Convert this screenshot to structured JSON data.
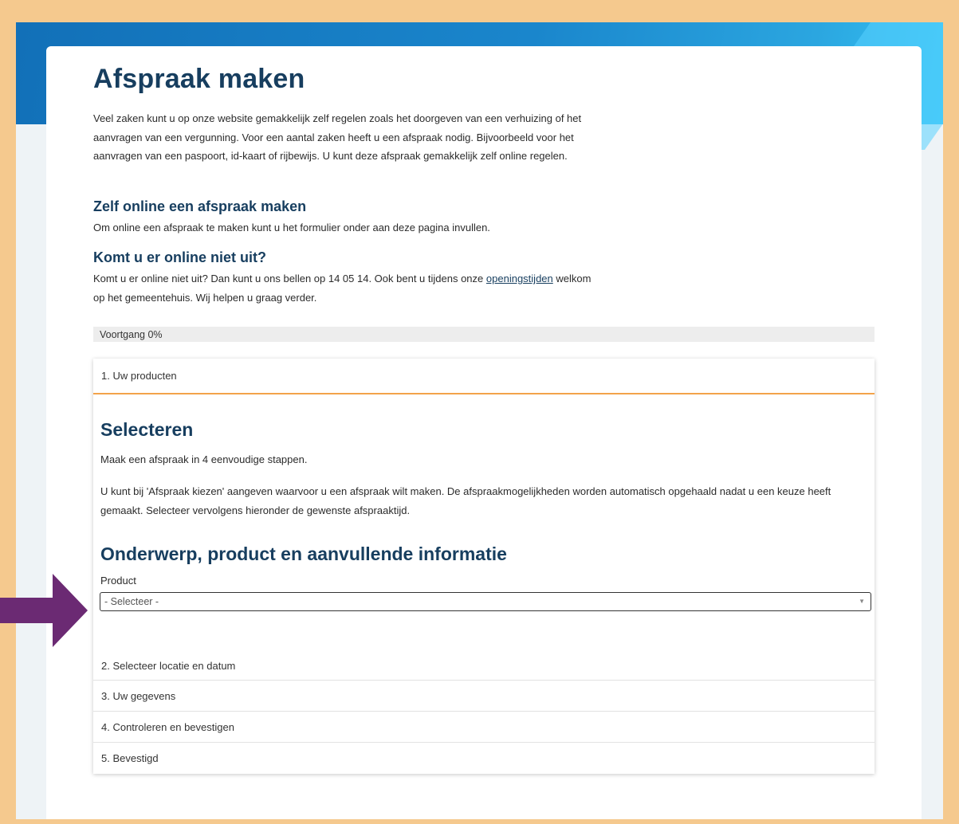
{
  "page": {
    "title": "Afspraak maken",
    "intro": "Veel zaken kunt u op onze website gemakkelijk zelf regelen zoals het doorgeven van een verhuizing of het aanvragen van een vergunning. Voor een aantal zaken heeft u een afspraak nodig. Bijvoorbeeld voor het aanvragen van een paspoort, id-kaart of rijbewijs. U kunt deze afspraak gemakkelijk zelf online regelen.",
    "section1": {
      "heading": "Zelf online een afspraak maken",
      "text": "Om online een afspraak te maken kunt u het formulier onder aan deze pagina invullen."
    },
    "section2": {
      "heading": "Komt u er online niet uit?",
      "text_before": "Komt u er online niet uit? Dan kunt u ons bellen op 14 05 14. Ook bent u tijdens onze",
      "link": "openingstijden",
      "text_after": "welkom op het gemeentehuis. Wij helpen u graag verder."
    }
  },
  "progress": {
    "label": "Voortgang 0%",
    "value": 0
  },
  "steps": {
    "step1": {
      "label": "1. Uw producten",
      "heading": "Selecteren",
      "text1": "Maak een afspraak in 4 eenvoudige stappen.",
      "text2": "U kunt bij 'Afspraak kiezen' aangeven waarvoor u een afspraak wilt maken. De afspraakmogelijkheden worden automatisch opgehaald nadat u een keuze heeft gemaakt. Selecteer vervolgens hieronder de gewenste afspraaktijd.",
      "subheading": "Onderwerp, product en aanvullende informatie",
      "field_label": "Product",
      "select_value": "- Selecteer -"
    },
    "step2": {
      "label": "2. Selecteer locatie en datum"
    },
    "step3": {
      "label": "3. Uw gegevens"
    },
    "step4": {
      "label": "4. Controleren en bevestigen"
    },
    "step5": {
      "label": "5. Bevestigd"
    }
  },
  "colors": {
    "border": "#f5c98e",
    "heading": "#173e5f",
    "accent": "#f3a34a",
    "arrow": "#6b2a73",
    "hero": "#1a86cc"
  },
  "icons": {
    "caret": "caret-down-icon",
    "arrow": "arrow-right-icon"
  }
}
